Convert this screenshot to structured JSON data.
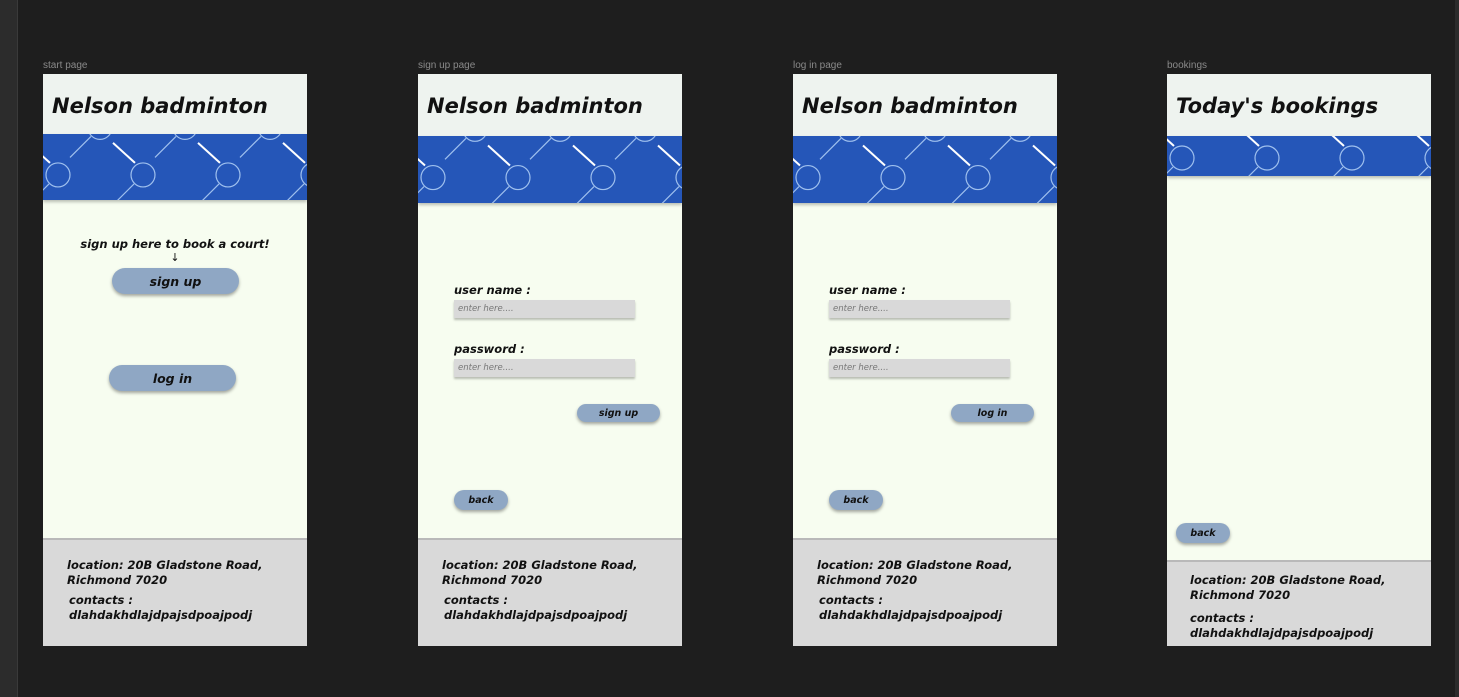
{
  "canvas": {
    "background": "#1e1e1e",
    "frames": {
      "start": {
        "label": "start page",
        "title": "Nelson badminton",
        "hint": "sign up here to book a court!",
        "arrow": "↓",
        "signup_label": "sign up",
        "login_label": "log in",
        "footer": {
          "location_line1": "location: 20B Gladstone Road,",
          "location_line2": "Richmond 7020",
          "contacts_label": "contacts :",
          "contacts_value": "dlahdakhdlajdpajsdpoajpodj"
        }
      },
      "signup": {
        "label": "sign up page",
        "title": "Nelson badminton",
        "username_label": "user name :",
        "username_placeholder": "enter here....",
        "password_label": "password :",
        "password_placeholder": "enter here....",
        "submit_label": "sign up",
        "back_label": "back",
        "footer": {
          "location_line1": "location: 20B Gladstone Road,",
          "location_line2": "Richmond 7020",
          "contacts_label": "contacts :",
          "contacts_value": "dlahdakhdlajdpajsdpoajpodj"
        }
      },
      "login": {
        "label": "log in page",
        "title": "Nelson badminton",
        "username_label": "user name :",
        "username_placeholder": "enter here....",
        "password_label": "password :",
        "password_placeholder": "enter here....",
        "submit_label": "log in",
        "back_label": "back",
        "footer": {
          "location_line1": "location: 20B Gladstone Road,",
          "location_line2": "Richmond 7020",
          "contacts_label": "contacts :",
          "contacts_value": "dlahdakhdlajdpajsdpoajpodj"
        }
      },
      "bookings": {
        "label": "bookings",
        "title": "Today's bookings",
        "back_label": "back",
        "footer": {
          "location_line1": "location: 20B Gladstone Road,",
          "location_line2": "Richmond 7020",
          "contacts_label": "contacts :",
          "contacts_value": "dlahdakhdlajdpajsdpoajpodj"
        }
      }
    },
    "colors": {
      "header_bg": "#eef3ef",
      "body_bg": "#f7fdf0",
      "banner_blue": "#2556b8",
      "racket_line": "#9fc0ee",
      "button_bg": "#8fa7c4",
      "field_bg": "#d9d9d9",
      "footer_bg": "#d9d9d9"
    },
    "icons": {
      "banner": "badminton-racket-pattern",
      "hint_arrow": "arrow-down-icon"
    }
  }
}
